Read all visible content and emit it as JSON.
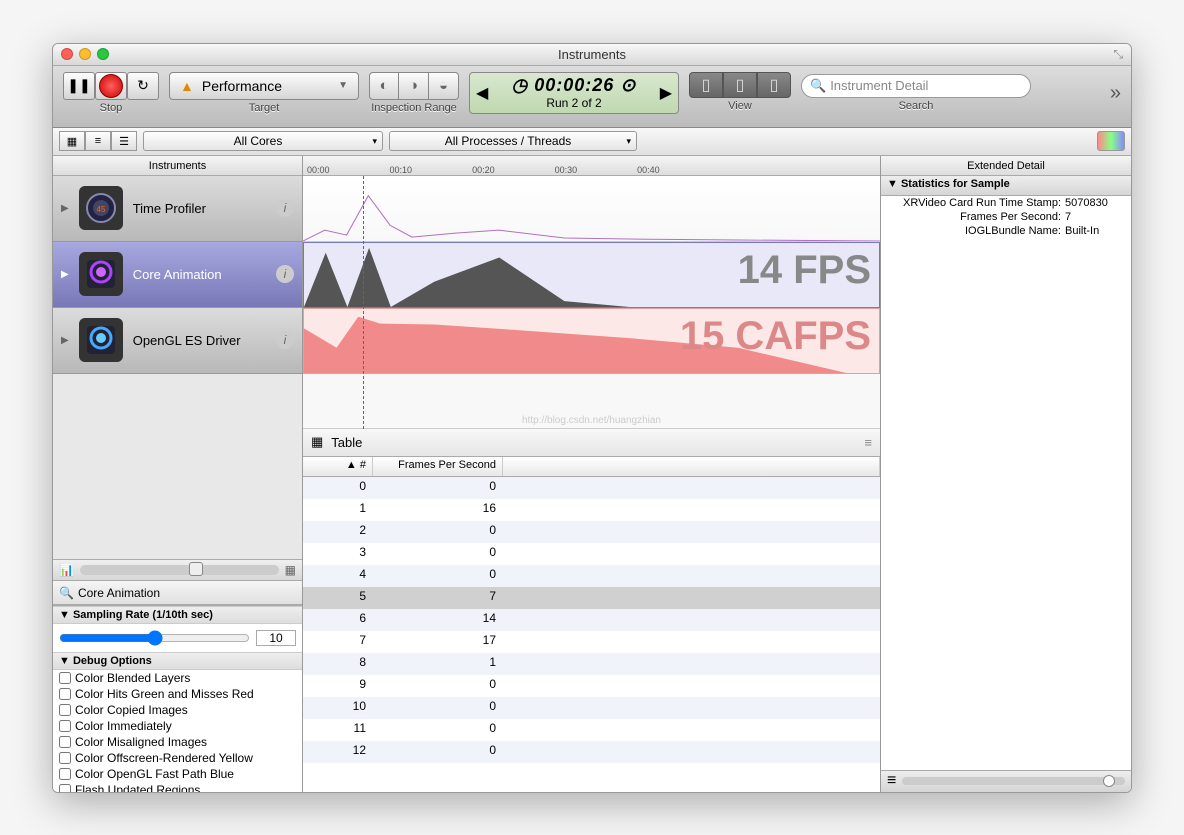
{
  "window": {
    "title": "Instruments"
  },
  "toolbar": {
    "stop_label": "Stop",
    "target_label": "Target",
    "target_value": "Performance",
    "inspection_label": "Inspection Range",
    "time": "00:00:26",
    "run_info": "Run 2 of 2",
    "view_label": "View",
    "search_label": "Search",
    "search_placeholder": "Instrument Detail"
  },
  "sub_toolbar": {
    "cores": "All Cores",
    "processes": "All Processes / Threads"
  },
  "panes": {
    "instruments_header": "Instruments",
    "extended_header": "Extended Detail"
  },
  "instruments": [
    {
      "name": "Time Profiler"
    },
    {
      "name": "Core Animation"
    },
    {
      "name": "OpenGL ES Driver"
    }
  ],
  "timeline": {
    "ticks": [
      "00:00",
      "00:10",
      "00:20",
      "00:30",
      "00:40"
    ],
    "fps_text": "14 FPS",
    "cafps_text": "15 CAFPS",
    "watermark": "http://blog.csdn.net/huangzhian"
  },
  "bottom_left": {
    "title": "Core Animation",
    "sampling_header": "Sampling Rate (1/10th sec)",
    "sampling_value": "10",
    "debug_header": "Debug Options",
    "options": [
      "Color Blended Layers",
      "Color Hits Green and Misses Red",
      "Color Copied Images",
      "Color Immediately",
      "Color Misaligned Images",
      "Color Offscreen-Rendered Yellow",
      "Color OpenGL Fast Path Blue",
      "Flash Updated Regions"
    ]
  },
  "details": {
    "mode": "Table",
    "columns": {
      "num": "#",
      "fps": "Frames Per Second"
    },
    "rows": [
      {
        "n": 0,
        "fps": 0
      },
      {
        "n": 1,
        "fps": 16
      },
      {
        "n": 2,
        "fps": 0
      },
      {
        "n": 3,
        "fps": 0
      },
      {
        "n": 4,
        "fps": 0
      },
      {
        "n": 5,
        "fps": 7
      },
      {
        "n": 6,
        "fps": 14
      },
      {
        "n": 7,
        "fps": 17
      },
      {
        "n": 8,
        "fps": 1
      },
      {
        "n": 9,
        "fps": 0
      },
      {
        "n": 10,
        "fps": 0
      },
      {
        "n": 11,
        "fps": 0
      },
      {
        "n": 12,
        "fps": 0
      }
    ],
    "selected_row": 5
  },
  "extended": {
    "section": "Statistics for Sample",
    "stats": [
      {
        "label": "XRVideo Card Run Time Stamp:",
        "value": "5070830"
      },
      {
        "label": "Frames Per Second:",
        "value": "7"
      },
      {
        "label": "IOGLBundle Name:",
        "value": "Built-In"
      }
    ]
  },
  "chart_data": [
    {
      "type": "area",
      "track": "Core Animation",
      "x": [
        0,
        1,
        2,
        3,
        4,
        5,
        6,
        7,
        8,
        9,
        10,
        11,
        12
      ],
      "values": [
        0,
        16,
        0,
        0,
        0,
        7,
        14,
        17,
        1,
        0,
        0,
        0,
        0
      ],
      "ylabel": "FPS",
      "ylim": [
        0,
        20
      ],
      "color": "#555"
    },
    {
      "type": "area",
      "track": "OpenGL ES Driver",
      "x": [
        0,
        1,
        2,
        3,
        4,
        5,
        6,
        7,
        8,
        9,
        10,
        11,
        12
      ],
      "values": [
        12,
        18,
        10,
        16,
        15,
        15,
        14,
        13,
        12,
        11,
        10,
        9,
        0
      ],
      "ylabel": "CAFPS",
      "ylim": [
        0,
        20
      ],
      "color": "#e06060"
    }
  ]
}
